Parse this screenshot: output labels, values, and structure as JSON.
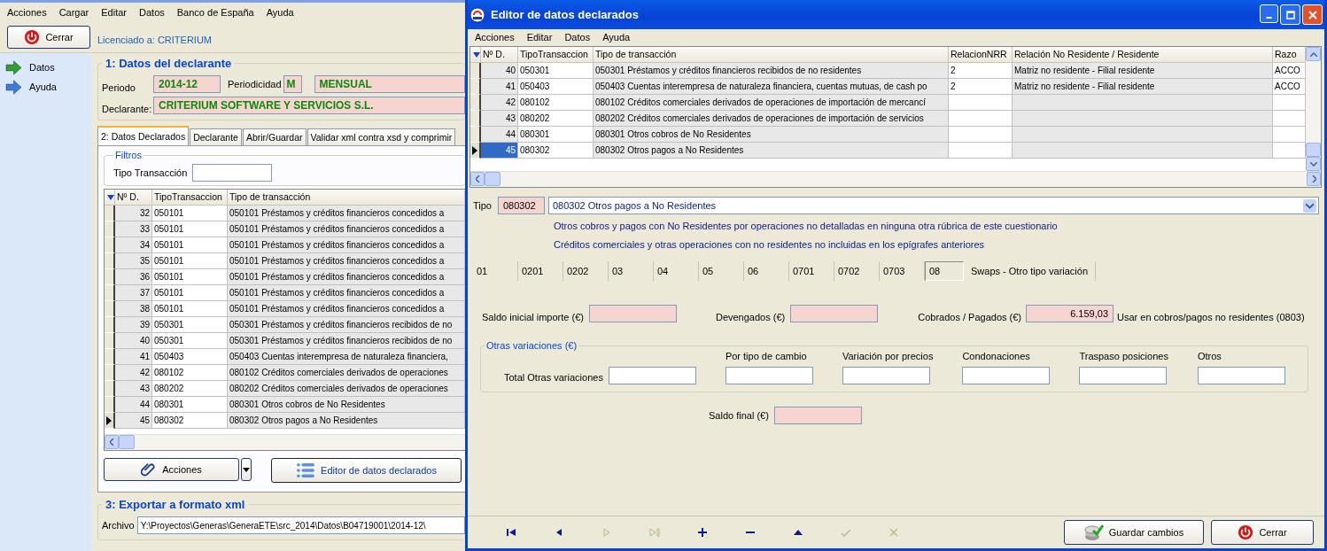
{
  "app": {
    "menu": [
      "Acciones",
      "Cargar",
      "Editar",
      "Datos",
      "Banco de España",
      "Ayuda"
    ],
    "close_button": "Cerrar",
    "license": "Licenciado a: CRITERIUM",
    "sidebar": [
      {
        "label": "Datos",
        "selected": true
      },
      {
        "label": "Ayuda",
        "selected": false
      }
    ],
    "declarante_section": {
      "title": "1: Datos del declarante",
      "periodo_label": "Periodo",
      "periodo": "2014-12",
      "periodicidad_label": "Periodicidad",
      "periodicidad_code": "M",
      "periodicidad": "MENSUAL",
      "declarante_label": "Declarante:",
      "declarante": "CRITERIUM SOFTWARE Y SERVICIOS S.L."
    },
    "tabs": [
      {
        "label": "2: Datos Declarados",
        "selected": true
      },
      {
        "label": "Declarante",
        "selected": false
      },
      {
        "label": "Abrir/Guardar",
        "selected": false
      },
      {
        "label": "Validar xml contra xsd y comprimir",
        "selected": false
      }
    ],
    "filters": {
      "title": "Filtros",
      "label": "Tipo Transacción"
    },
    "table": {
      "columns": [
        "Nº D.",
        "TipoTransaccion",
        "Tipo de transacción"
      ],
      "rows": [
        {
          "nd": "32",
          "tipo": "050101",
          "descripcion": "050101 Préstamos y créditos financieros concedidos a",
          "selected": false
        },
        {
          "nd": "33",
          "tipo": "050101",
          "descripcion": "050101 Préstamos y créditos financieros concedidos a",
          "selected": false
        },
        {
          "nd": "34",
          "tipo": "050101",
          "descripcion": "050101 Préstamos y créditos financieros concedidos a",
          "selected": false
        },
        {
          "nd": "35",
          "tipo": "050101",
          "descripcion": "050101 Préstamos y créditos financieros concedidos a",
          "selected": false
        },
        {
          "nd": "36",
          "tipo": "050101",
          "descripcion": "050101 Préstamos y créditos financieros concedidos a",
          "selected": false
        },
        {
          "nd": "37",
          "tipo": "050101",
          "descripcion": "050101 Préstamos y créditos financieros concedidos a",
          "selected": false
        },
        {
          "nd": "38",
          "tipo": "050101",
          "descripcion": "050101 Préstamos y créditos financieros concedidos a",
          "selected": false
        },
        {
          "nd": "39",
          "tipo": "050301",
          "descripcion": "050301 Préstamos y créditos financieros recibidos de no",
          "selected": false
        },
        {
          "nd": "40",
          "tipo": "050301",
          "descripcion": "050301 Préstamos y créditos financieros recibidos de no",
          "selected": false
        },
        {
          "nd": "41",
          "tipo": "050403",
          "descripcion": "050403 Cuentas interempresa de naturaleza financiera,",
          "selected": false
        },
        {
          "nd": "42",
          "tipo": "080102",
          "descripcion": "080102 Créditos comerciales derivados de operaciones",
          "selected": false
        },
        {
          "nd": "43",
          "tipo": "080202",
          "descripcion": "080202 Créditos comerciales derivados de operaciones",
          "selected": false
        },
        {
          "nd": "44",
          "tipo": "080301",
          "descripcion": "080301 Otros cobros de No Residentes",
          "selected": false
        },
        {
          "nd": "45",
          "tipo": "080302",
          "descripcion": "080302 Otros pagos a No Residentes",
          "selected": true
        }
      ]
    },
    "acciones_button": "Acciones",
    "editor_button": "Editor de datos declarados",
    "export_section": {
      "title": "3: Exportar a formato xml",
      "archivo_label": "Archivo",
      "archivo": "Y:\\Proyectos\\Generas\\GeneraETE\\src_2014\\Datos\\B04719001\\2014-12\\"
    }
  },
  "editor": {
    "title": "Editor de datos declarados",
    "menu": [
      "Acciones",
      "Editar",
      "Datos",
      "Ayuda"
    ],
    "table": {
      "columns": [
        "Nº D.",
        "TipoTransaccion",
        "Tipo de transacción",
        "RelacionNRR",
        "Relación No Residente / Residente",
        "Razo"
      ],
      "rows": [
        {
          "nd": "40",
          "tipo": "050301",
          "descripcion": "050301 Préstamos y créditos financieros recibidos de no residentes",
          "relacion_nrr": "2",
          "relacion": "Matriz no residente - Filial residente",
          "razon": "ACCO",
          "selected": false
        },
        {
          "nd": "41",
          "tipo": "050403",
          "descripcion": "050403 Cuentas interempresa de naturaleza financiera, cuentas mutuas, de cash po",
          "relacion_nrr": "2",
          "relacion": "Matriz no residente - Filial residente",
          "razon": "ACCO",
          "selected": false
        },
        {
          "nd": "42",
          "tipo": "080102",
          "descripcion": "080102 Créditos comerciales derivados de operaciones de importación de mercancí",
          "selected": false
        },
        {
          "nd": "43",
          "tipo": "080202",
          "descripcion": "080202 Créditos comerciales derivados de operaciones de importación de servicios",
          "selected": false
        },
        {
          "nd": "44",
          "tipo": "080301",
          "descripcion": "080301 Otros cobros de No Residentes",
          "selected": false
        },
        {
          "nd": "45",
          "tipo": "080302",
          "descripcion": "080302 Otros pagos a No Residentes",
          "selected": true
        }
      ]
    },
    "tipo_label": "Tipo",
    "tipo_code": "080302",
    "tipo_value": "080302 Otros pagos a No Residentes",
    "description_lines": [
      "Otros cobros y pagos con No Residentes por operaciones no detalladas en ninguna otra rúbrica de este cuestionario",
      "Créditos comerciales y otras operaciones con no residentes no incluidas en los epígrafes anteriores"
    ],
    "codes": [
      {
        "label": "01",
        "selected": false
      },
      {
        "label": "0201",
        "selected": false
      },
      {
        "label": "0202",
        "selected": false
      },
      {
        "label": "03",
        "selected": false
      },
      {
        "label": "04",
        "selected": false
      },
      {
        "label": "05",
        "selected": false
      },
      {
        "label": "06",
        "selected": false
      },
      {
        "label": "0701",
        "selected": false
      },
      {
        "label": "0702",
        "selected": false
      },
      {
        "label": "0703",
        "selected": false
      },
      {
        "label": "08",
        "selected": true
      }
    ],
    "code_description": "Swaps - Otro tipo variación",
    "importes": [
      {
        "label": "Saldo inicial importe (€)"
      },
      {
        "label": "Devengados (€)"
      },
      {
        "label": "Cobrados / Pagados (€)",
        "value": "6.159,03"
      }
    ],
    "usage_note": "Usar en cobros/pagos no residentes (0803)",
    "otras_variaciones": {
      "title": "Otras variaciones (€)",
      "total_label": "Total Otras variaciones",
      "columns": [
        "Por tipo de cambio",
        "Variación por precios",
        "Condonaciones",
        "Traspaso posiciones",
        "Otros"
      ]
    },
    "saldo_final_label": "Saldo final (€)",
    "nav_buttons": [
      {
        "kind": "first",
        "disabled": false
      },
      {
        "kind": "prior",
        "disabled": false
      },
      {
        "kind": "next",
        "disabled": true
      },
      {
        "kind": "last",
        "disabled": true
      },
      {
        "kind": "insert",
        "disabled": false
      },
      {
        "kind": "delete",
        "disabled": false
      },
      {
        "kind": "edit",
        "disabled": false
      },
      {
        "kind": "post",
        "disabled": true
      },
      {
        "kind": "cancel",
        "disabled": true
      }
    ],
    "save_button": "Guardar cambios",
    "close_button": "Cerrar"
  }
}
